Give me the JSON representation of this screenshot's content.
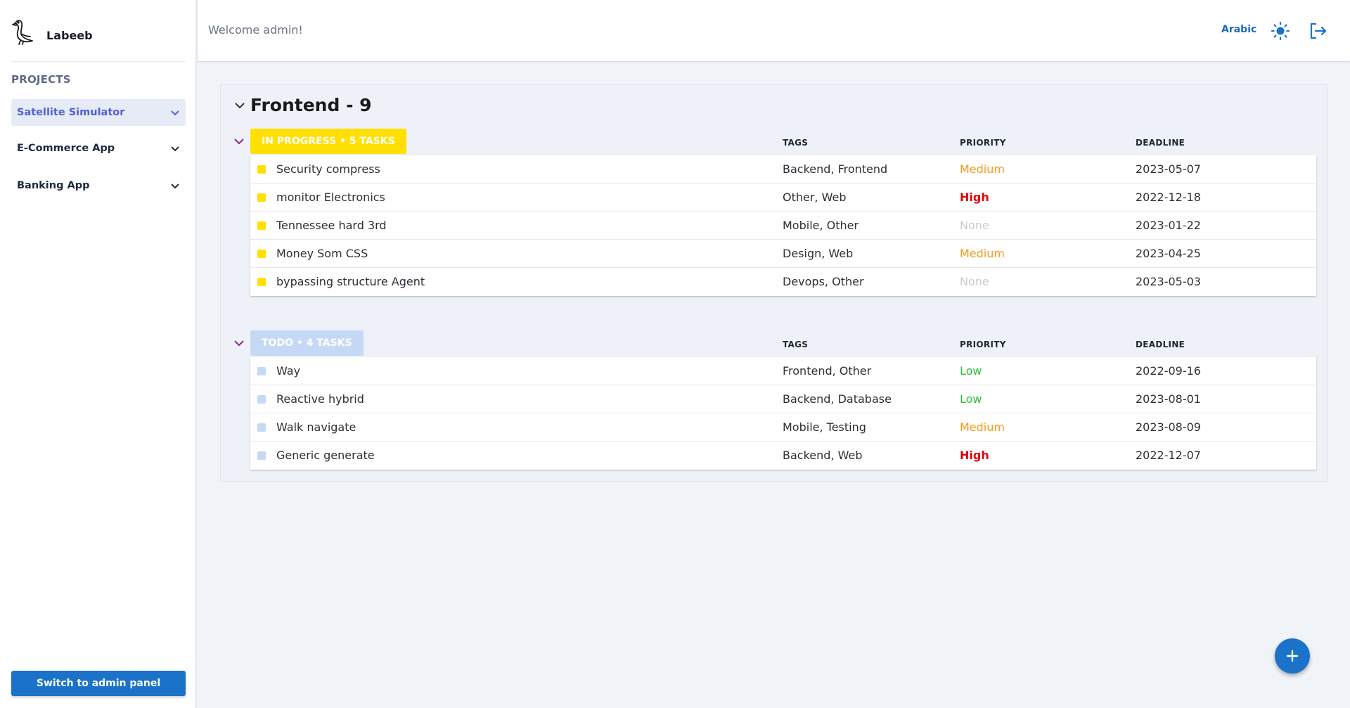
{
  "brand": {
    "name": "Labeeb"
  },
  "sidebar": {
    "projects_title": "PROJECTS",
    "items": [
      {
        "label": "Satellite Simulator",
        "active": true
      },
      {
        "label": "E-Commerce App",
        "active": false
      },
      {
        "label": "Banking App",
        "active": false
      }
    ],
    "admin_button": "Switch to admin panel"
  },
  "header": {
    "welcome": "Welcome admin!",
    "language": "Arabic",
    "theme_icon": "sun-icon",
    "logout_icon": "logout-icon"
  },
  "group": {
    "title": "Frontend - 9",
    "sections": [
      {
        "badge": "IN PROGRESS • 5 TASKS",
        "badge_color": "#ffe000",
        "square_color": "#ffe000",
        "columns": {
          "tags": "TAGS",
          "priority": "PRIORITY",
          "deadline": "DEADLINE"
        },
        "tasks": [
          {
            "name": "Security compress",
            "tags": "Backend, Frontend",
            "priority": "Medium",
            "priority_level": "medium",
            "deadline": "2023-05-07"
          },
          {
            "name": "monitor Electronics",
            "tags": "Other, Web",
            "priority": "High",
            "priority_level": "high",
            "deadline": "2022-12-18"
          },
          {
            "name": "Tennessee hard 3rd",
            "tags": "Mobile, Other",
            "priority": "None",
            "priority_level": "none",
            "deadline": "2023-01-22"
          },
          {
            "name": "Money Som CSS",
            "tags": "Design, Web",
            "priority": "Medium",
            "priority_level": "medium",
            "deadline": "2023-04-25"
          },
          {
            "name": "bypassing structure Agent",
            "tags": "Devops, Other",
            "priority": "None",
            "priority_level": "none",
            "deadline": "2023-05-03"
          }
        ]
      },
      {
        "badge": "TODO • 4 TASKS",
        "badge_color": "#c5d9f7",
        "square_color": "#c5d9f7",
        "columns": {
          "tags": "TAGS",
          "priority": "PRIORITY",
          "deadline": "DEADLINE"
        },
        "tasks": [
          {
            "name": "Way",
            "tags": "Frontend, Other",
            "priority": "Low",
            "priority_level": "low",
            "deadline": "2022-09-16"
          },
          {
            "name": "Reactive hybrid",
            "tags": "Backend, Database",
            "priority": "Low",
            "priority_level": "low",
            "deadline": "2023-08-01"
          },
          {
            "name": "Walk navigate",
            "tags": "Mobile, Testing",
            "priority": "Medium",
            "priority_level": "medium",
            "deadline": "2023-08-09"
          },
          {
            "name": "Generic generate",
            "tags": "Backend, Web",
            "priority": "High",
            "priority_level": "high",
            "deadline": "2022-12-07"
          }
        ]
      }
    ]
  },
  "fab_icon": "plus-icon",
  "colors": {
    "accent": "#1a73c9",
    "active_project": "#5060d8",
    "section_chevron": "#8a2a8a"
  }
}
